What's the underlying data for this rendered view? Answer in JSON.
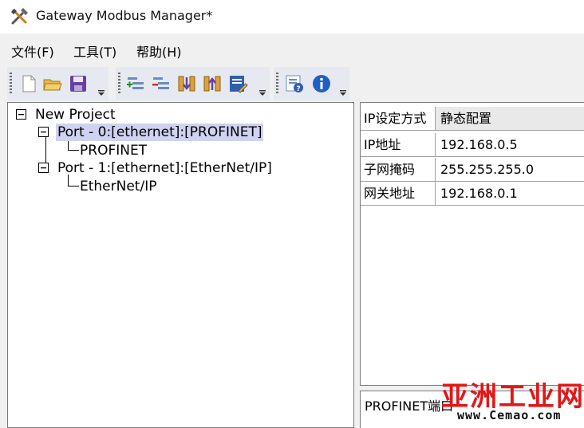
{
  "window": {
    "title": "Gateway Modbus Manager*"
  },
  "menu": {
    "items": [
      {
        "label": "文件(F)"
      },
      {
        "label": "工具(T)"
      },
      {
        "label": "帮助(H)"
      }
    ]
  },
  "toolbar": {
    "icons": [
      "new-file-icon",
      "open-folder-icon",
      "save-icon",
      "add-port-icon",
      "remove-port-icon",
      "import-icon",
      "export-icon",
      "edit-icon",
      "help-contents-icon",
      "about-icon"
    ]
  },
  "tree": {
    "root": {
      "label": "New Project"
    },
    "ports": [
      {
        "label": "Port - 0:[ethernet]:[PROFINET]",
        "child": "PROFINET"
      },
      {
        "label": "Port - 1:[ethernet]:[EtherNet/IP]",
        "child": "EtherNet/IP"
      }
    ]
  },
  "properties": {
    "rows": [
      {
        "name": "IP设定方式",
        "value": "静态配置"
      },
      {
        "name": "IP地址",
        "value": "192.168.0.5"
      },
      {
        "name": "子网掩码",
        "value": "255.255.255.0"
      },
      {
        "name": "网关地址",
        "value": "192.168.0.1"
      }
    ]
  },
  "description": {
    "text": "PROFINET端口"
  },
  "watermark": {
    "main": "亚洲工业网",
    "sub": "www.Cemao.com"
  },
  "colors": {
    "selection": "#cfd2f0",
    "watermark": "#e01818",
    "toolbar_bg": "#e6e9ef"
  }
}
